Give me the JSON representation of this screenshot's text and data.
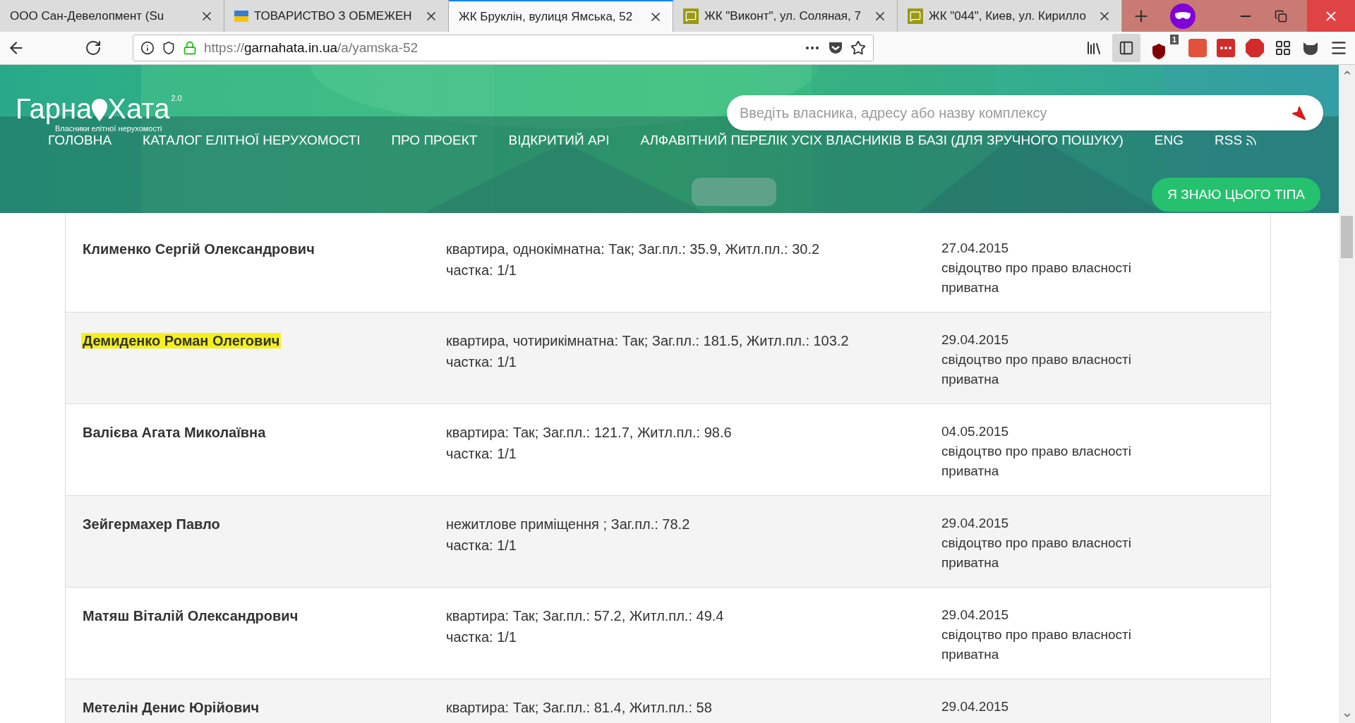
{
  "browser": {
    "tabs": [
      {
        "title": "ООО Сан-Девелопмент (Su",
        "selected": false
      },
      {
        "title": "ТОВАРИСТВО З ОБМЕЖЕН",
        "selected": false,
        "kind": "flag"
      },
      {
        "title": "ЖК Бруклін, вулиця Ямська, 52",
        "selected": true
      },
      {
        "title": "ЖК \"Виконт\", ул. Соляная, 7",
        "selected": false,
        "kind": "chat"
      },
      {
        "title": "ЖК \"044\", Киев, ул. Кирилло",
        "selected": false,
        "kind": "chat"
      }
    ],
    "url": {
      "scheme": "https://",
      "host": "garnahata.in.ua",
      "path": "/a/yamska-52"
    },
    "extension_badge": "1"
  },
  "site": {
    "logo": {
      "left": "Гарна",
      "right": "Хата",
      "version": "2.0",
      "tagline": "Власники елітної нерухомості"
    },
    "search": {
      "placeholder": "Введіть власника, адресу або назву комплексу"
    },
    "nav": [
      {
        "label": "ГОЛОВНА",
        "kind": "link"
      },
      {
        "label": "КАТАЛОГ ЕЛІТНОЇ НЕРУХОМОСТІ",
        "kind": "link"
      },
      {
        "label": "ПРО ПРОЕКТ",
        "kind": "link"
      },
      {
        "label": "ВІДКРИТИЙ API",
        "kind": "link"
      },
      {
        "label": "АЛФАВІТНИЙ ПЕРЕЛІК УСІХ ВЛАСНИКІВ В БАЗІ (ДЛЯ ЗРУЧНОГО ПОШУКУ)",
        "kind": "link"
      },
      {
        "label": "ENG",
        "kind": "link"
      },
      {
        "label": "RSS",
        "kind": "feed"
      }
    ],
    "cta": "Я ЗНАЮ ЦЬОГО ТІПА"
  },
  "rows": [
    {
      "name": "Клименко Сергій Олександрович",
      "highlighted": false,
      "property": [
        "квартира, однокімнатна: Так; Заг.пл.: 35.9, Житл.пл.: 30.2",
        "частка: 1/1"
      ],
      "document": [
        "27.04.2015",
        "свідоцтво про право власності",
        "приватна"
      ]
    },
    {
      "name": "Демиденко Роман Олегович",
      "highlighted": true,
      "property": [
        "квартира, чотирикімнатна: Так; Заг.пл.: 181.5, Житл.пл.: 103.2",
        "частка: 1/1"
      ],
      "document": [
        "29.04.2015",
        "свідоцтво про право власності",
        "приватна"
      ]
    },
    {
      "name": "Валієва Агата Миколаївна",
      "highlighted": false,
      "property": [
        "квартира: Так; Заг.пл.: 121.7, Житл.пл.: 98.6",
        "частка: 1/1"
      ],
      "document": [
        "04.05.2015",
        "свідоцтво про право власності",
        "приватна"
      ]
    },
    {
      "name": "Зейгермахер Павло",
      "highlighted": false,
      "property": [
        "нежитлове приміщення ; Заг.пл.: 78.2",
        "частка: 1/1"
      ],
      "document": [
        "29.04.2015",
        "свідоцтво про право власності",
        "приватна"
      ]
    },
    {
      "name": "Матяш Віталій Олександрович",
      "highlighted": false,
      "property": [
        "квартира: Так; Заг.пл.: 57.2, Житл.пл.: 49.4",
        "частка: 1/1"
      ],
      "document": [
        "29.04.2015",
        "свідоцтво про право власності",
        "приватна"
      ]
    },
    {
      "name": "Метелін Денис Юрійович",
      "highlighted": false,
      "property": [
        "квартира: Так; Заг.пл.: 81.4, Житл.пл.: 58"
      ],
      "document": [
        "29.04.2015"
      ]
    }
  ]
}
